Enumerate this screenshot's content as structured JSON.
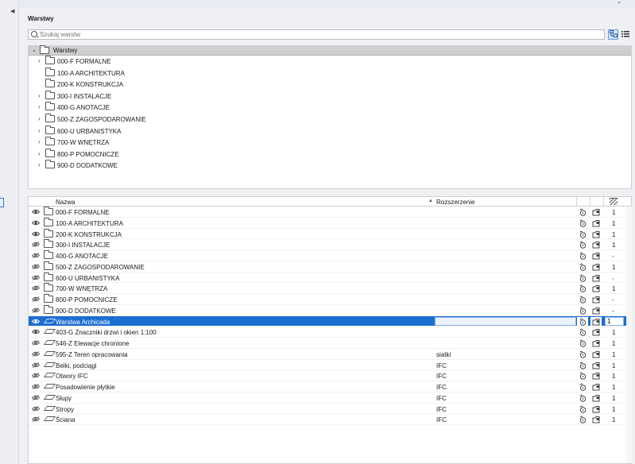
{
  "panel": {
    "title": "Warstwy"
  },
  "search": {
    "placeholder": "Szukaj warstw"
  },
  "tree": {
    "root": "Warstwy",
    "items": [
      {
        "label": "000-F FORMALNE",
        "expandable": true
      },
      {
        "label": "100-A ARCHITEKTURA",
        "expandable": false
      },
      {
        "label": "200-K KONSTRUKCJA",
        "expandable": false
      },
      {
        "label": "300-I INSTALACJE",
        "expandable": true
      },
      {
        "label": "400-G ANOTACJE",
        "expandable": true
      },
      {
        "label": "500-Z ZAGOSPODAROWANIE",
        "expandable": true
      },
      {
        "label": "600-U URBANISTYKA",
        "expandable": true
      },
      {
        "label": "700-W WNĘTRZA",
        "expandable": true
      },
      {
        "label": "800-P POMOCNICZE",
        "expandable": true
      },
      {
        "label": "900-D DODATKOWE",
        "expandable": true
      }
    ]
  },
  "table": {
    "col_name": "Nazwa",
    "col_ext": "Rozszerzenie",
    "rows": [
      {
        "name": "000-F FORMALNE",
        "type": "folder",
        "visible": true,
        "ext": "",
        "num": "1"
      },
      {
        "name": "100-A ARCHITEKTURA",
        "type": "folder",
        "visible": true,
        "ext": "",
        "num": "1"
      },
      {
        "name": "200-K KONSTRUKCJA",
        "type": "folder",
        "visible": true,
        "ext": "",
        "num": "1"
      },
      {
        "name": "300-I INSTALACJE",
        "type": "folder",
        "visible": false,
        "ext": "",
        "num": "1"
      },
      {
        "name": "400-G ANOTACJE",
        "type": "folder",
        "visible": false,
        "ext": "",
        "num": "-"
      },
      {
        "name": "500-Z ZAGOSPODAROWANIE",
        "type": "folder",
        "visible": false,
        "ext": "",
        "num": "1"
      },
      {
        "name": "600-U URBANISTYKA",
        "type": "folder",
        "visible": false,
        "ext": "",
        "num": "-"
      },
      {
        "name": "700-W WNĘTRZA",
        "type": "folder",
        "visible": false,
        "ext": "",
        "num": "1"
      },
      {
        "name": "800-P POMOCNICZE",
        "type": "folder",
        "visible": false,
        "ext": "",
        "num": "-"
      },
      {
        "name": "900-D DODATKOWE",
        "type": "folder",
        "visible": false,
        "ext": "",
        "num": "-"
      },
      {
        "name": "Warstwa Archicada",
        "type": "layer",
        "visible": true,
        "ext": "",
        "num": "1",
        "selected": true
      },
      {
        "name": "403-G Znaczniki drzwi i okien 1:100",
        "type": "layer",
        "visible": true,
        "ext": "",
        "num": "1"
      },
      {
        "name": "546-Z Elewacje chronione",
        "type": "layer",
        "visible": false,
        "ext": "",
        "num": "1"
      },
      {
        "name": "595-Z Teren opracowania",
        "type": "layer",
        "visible": false,
        "ext": "siatki",
        "num": "1"
      },
      {
        "name": "Belki, podciągi",
        "type": "layer",
        "visible": false,
        "ext": "IFC",
        "num": "1"
      },
      {
        "name": "Otwory IFC",
        "type": "layer",
        "visible": false,
        "ext": "IFC",
        "num": "1"
      },
      {
        "name": "Posadowienie płytkie",
        "type": "layer",
        "visible": false,
        "ext": "IFC",
        "num": "1"
      },
      {
        "name": "Słupy",
        "type": "layer",
        "visible": false,
        "ext": "IFC",
        "num": "1"
      },
      {
        "name": "Stropy",
        "type": "layer",
        "visible": false,
        "ext": "IFC",
        "num": "1"
      },
      {
        "name": "Ściana",
        "type": "layer",
        "visible": false,
        "ext": "IFC",
        "num": "1"
      }
    ]
  }
}
